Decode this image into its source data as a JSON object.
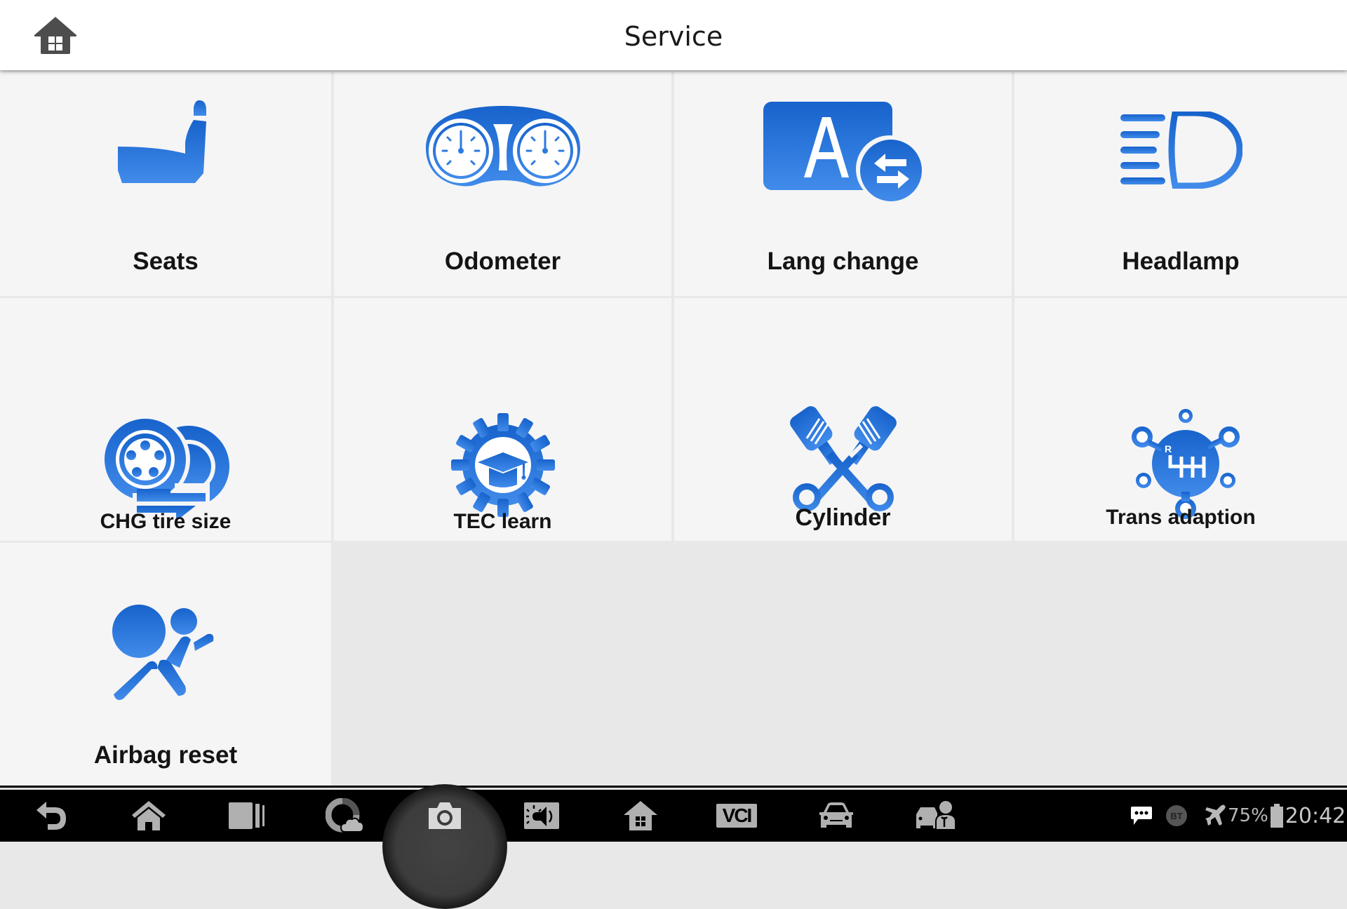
{
  "header": {
    "title": "Service",
    "home_icon": "home-icon"
  },
  "accent_color": "#2d7ae0",
  "tiles": [
    {
      "label": "Seats",
      "icon": "seat-icon"
    },
    {
      "label": "Odometer",
      "icon": "odometer-icon"
    },
    {
      "label": "Lang change",
      "icon": "language-change-icon"
    },
    {
      "label": "Headlamp",
      "icon": "headlamp-icon"
    },
    {
      "label": "CHG tire size",
      "icon": "tire-size-icon"
    },
    {
      "label": "TEC learn",
      "icon": "tec-learn-icon"
    },
    {
      "label": "Cylinder",
      "icon": "cylinder-icon"
    },
    {
      "label": "Trans adaption",
      "icon": "transmission-icon"
    },
    {
      "label": "Airbag reset",
      "icon": "airbag-icon"
    }
  ],
  "navbar": {
    "buttons": [
      {
        "name": "back",
        "icon": "back-icon"
      },
      {
        "name": "home",
        "icon": "home-icon"
      },
      {
        "name": "recent-apps",
        "icon": "recent-apps-icon"
      },
      {
        "name": "cloud",
        "icon": "cloud-icon"
      },
      {
        "name": "screenshot",
        "icon": "camera-icon"
      },
      {
        "name": "display-sound",
        "icon": "brightness-volume-icon"
      },
      {
        "name": "autel-home",
        "icon": "house-grid-icon"
      },
      {
        "name": "vci",
        "icon": "vci-icon",
        "label": "VCI"
      },
      {
        "name": "vehicle",
        "icon": "car-icon"
      },
      {
        "name": "technician",
        "icon": "car-technician-icon"
      }
    ],
    "status": {
      "notification_icon": "message-icon",
      "bt_label": "BT",
      "airplane_icon": "airplane-icon",
      "battery_percent": "75%",
      "battery_icon": "battery-icon",
      "time": "20:42"
    }
  }
}
